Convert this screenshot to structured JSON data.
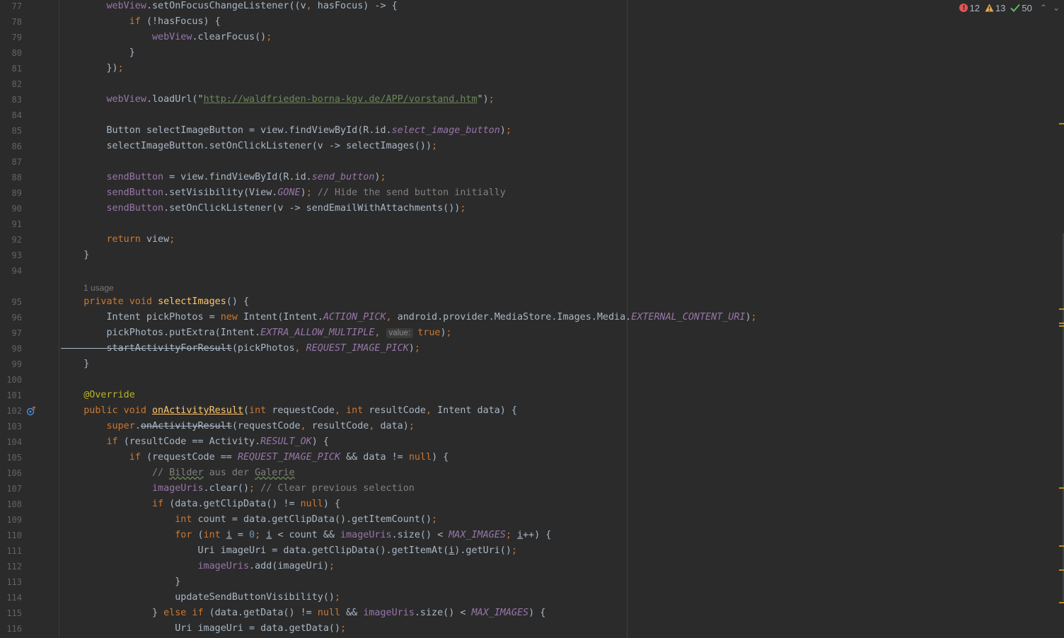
{
  "editor": {
    "usage_hint": "1 usage",
    "inlay_hint": "value:",
    "first_line": 77
  },
  "inspections": {
    "errors": "12",
    "warnings": "13",
    "weak_warnings": "50",
    "error_icon": "error-circle-icon",
    "warning_icon": "warning-triangle-icon",
    "ok_icon": "checkmark-icon",
    "colors": {
      "error": "#e05555",
      "warning": "#e0a84e",
      "ok": "#5fb85f",
      "stripe_mark": "#be9117"
    }
  },
  "code_lines": [
    {
      "n": "77",
      "t": [
        [
          "fld",
          "        webView"
        ],
        [
          "p",
          ".setOnFocusChangeListener((v"
        ],
        [
          "kw",
          ", "
        ],
        [
          "p",
          "hasFocus) -> {"
        ]
      ]
    },
    {
      "n": "78",
      "t": [
        [
          "kw",
          "            if "
        ],
        [
          "p",
          "(!hasFocus) {"
        ]
      ]
    },
    {
      "n": "79",
      "t": [
        [
          "fld",
          "                webView"
        ],
        [
          "p",
          ".clearFocus()"
        ],
        [
          "kw",
          ";"
        ]
      ]
    },
    {
      "n": "80",
      "t": [
        [
          "p",
          "            }"
        ]
      ]
    },
    {
      "n": "81",
      "t": [
        [
          "p",
          "        })"
        ],
        [
          "kw",
          ";"
        ]
      ]
    },
    {
      "n": "82",
      "t": []
    },
    {
      "n": "83",
      "t": [
        [
          "fld",
          "        webView"
        ],
        [
          "p",
          ".loadUrl(\""
        ],
        [
          "str",
          "http://waldfrieden-borna-kgv.de/APP/vorstand.htm"
        ],
        [
          "p",
          "\")"
        ],
        [
          "kw",
          ";"
        ]
      ]
    },
    {
      "n": "84",
      "t": []
    },
    {
      "n": "85",
      "t": [
        [
          "p",
          "        Button selectImageButton = view.findViewById(R.id."
        ],
        [
          "sfld",
          "select_image_button"
        ],
        [
          "p",
          ")"
        ],
        [
          "kw",
          ";"
        ]
      ]
    },
    {
      "n": "86",
      "t": [
        [
          "p",
          "        selectImageButton.setOnClickListener(v -> selectImages())"
        ],
        [
          "kw",
          ";"
        ]
      ]
    },
    {
      "n": "87",
      "t": []
    },
    {
      "n": "88",
      "t": [
        [
          "fld",
          "        sendButton"
        ],
        [
          "p",
          " = view.findViewById(R.id."
        ],
        [
          "sfld",
          "send_button"
        ],
        [
          "p",
          ")"
        ],
        [
          "kw",
          ";"
        ]
      ]
    },
    {
      "n": "89",
      "t": [
        [
          "fld",
          "        sendButton"
        ],
        [
          "p",
          ".setVisibility(View."
        ],
        [
          "sfld",
          "GONE"
        ],
        [
          "p",
          ")"
        ],
        [
          "kw",
          "; "
        ],
        [
          "cmt",
          "// Hide the send button initially"
        ]
      ]
    },
    {
      "n": "90",
      "t": [
        [
          "fld",
          "        sendButton"
        ],
        [
          "p",
          ".setOnClickListener(v -> sendEmailWithAttachments())"
        ],
        [
          "kw",
          ";"
        ]
      ]
    },
    {
      "n": "91",
      "t": []
    },
    {
      "n": "92",
      "t": [
        [
          "kw",
          "        return "
        ],
        [
          "p",
          "view"
        ],
        [
          "kw",
          ";"
        ]
      ]
    },
    {
      "n": "93",
      "t": [
        [
          "p",
          "    }"
        ]
      ]
    },
    {
      "n": "94",
      "t": []
    },
    {
      "hint": true
    },
    {
      "n": "95",
      "t": [
        [
          "kw",
          "    private void "
        ],
        [
          "mdecl",
          "selectImages"
        ],
        [
          "p",
          "() {"
        ]
      ]
    },
    {
      "n": "96",
      "t": [
        [
          "p",
          "        Intent pickPhotos = "
        ],
        [
          "kw",
          "new "
        ],
        [
          "p",
          "Intent(Intent."
        ],
        [
          "sfld",
          "ACTION_PICK"
        ],
        [
          "kw",
          ", "
        ],
        [
          "p",
          "android.provider.MediaStore.Images.Media."
        ],
        [
          "sfld",
          "EXTERNAL_CONTENT_URI"
        ],
        [
          "p",
          ")"
        ],
        [
          "kw",
          ";"
        ]
      ]
    },
    {
      "n": "97",
      "t": [
        [
          "p",
          "        pickPhotos.putExtra(Intent."
        ],
        [
          "sfld",
          "EXTRA_ALLOW_MULTIPLE"
        ],
        [
          "kw",
          ", "
        ],
        [
          "inlay",
          "value:"
        ],
        [
          "kw",
          "true"
        ],
        [
          "p",
          ")"
        ],
        [
          "kw",
          ";"
        ]
      ]
    },
    {
      "n": "98",
      "t": [
        [
          "strike",
          "        startActivityForResult"
        ],
        [
          "p",
          "(pickPhotos"
        ],
        [
          "kw",
          ", "
        ],
        [
          "sfld",
          "REQUEST_IMAGE_PICK"
        ],
        [
          "p",
          ")"
        ],
        [
          "kw",
          ";"
        ]
      ]
    },
    {
      "n": "99",
      "t": [
        [
          "p",
          "    }"
        ]
      ]
    },
    {
      "n": "100",
      "t": []
    },
    {
      "n": "101",
      "t": [
        [
          "ann",
          "    @Override"
        ]
      ]
    },
    {
      "n": "102",
      "icon": true,
      "t": [
        [
          "kw",
          "    public void "
        ],
        [
          "mdeclstrike",
          "onActivityResult"
        ],
        [
          "p",
          "("
        ],
        [
          "kw",
          "int "
        ],
        [
          "p",
          "requestCode"
        ],
        [
          "kw",
          ", int "
        ],
        [
          "p",
          "resultCode"
        ],
        [
          "kw",
          ", "
        ],
        [
          "p",
          "Intent data) {"
        ]
      ]
    },
    {
      "n": "103",
      "t": [
        [
          "kw",
          "        super"
        ],
        [
          "p",
          "."
        ],
        [
          "strike",
          "onActivityResult"
        ],
        [
          "p",
          "(requestCode"
        ],
        [
          "kw",
          ", "
        ],
        [
          "p",
          "resultCode"
        ],
        [
          "kw",
          ", "
        ],
        [
          "p",
          "data)"
        ],
        [
          "kw",
          ";"
        ]
      ]
    },
    {
      "n": "104",
      "t": [
        [
          "kw",
          "        if "
        ],
        [
          "p",
          "(resultCode == Activity."
        ],
        [
          "sfld",
          "RESULT_OK"
        ],
        [
          "p",
          ") {"
        ]
      ]
    },
    {
      "n": "105",
      "t": [
        [
          "kw",
          "            if "
        ],
        [
          "p",
          "(requestCode == "
        ],
        [
          "sfld",
          "REQUEST_IMAGE_PICK"
        ],
        [
          "p",
          " && data != "
        ],
        [
          "kw",
          "null"
        ],
        [
          "p",
          ") {"
        ]
      ]
    },
    {
      "n": "106",
      "t": [
        [
          "cmt",
          "                // "
        ],
        [
          "cmtsq",
          "Bilder"
        ],
        [
          "cmt",
          " aus der "
        ],
        [
          "cmtsq",
          "Galerie"
        ]
      ]
    },
    {
      "n": "107",
      "t": [
        [
          "fld",
          "                imageUris"
        ],
        [
          "p",
          ".clear()"
        ],
        [
          "kw",
          "; "
        ],
        [
          "cmt",
          "// Clear previous selection"
        ]
      ]
    },
    {
      "n": "108",
      "t": [
        [
          "kw",
          "                if "
        ],
        [
          "p",
          "(data.getClipData() != "
        ],
        [
          "kw",
          "null"
        ],
        [
          "p",
          ") {"
        ]
      ]
    },
    {
      "n": "109",
      "t": [
        [
          "kw",
          "                    int "
        ],
        [
          "p",
          "count = data.getClipData().getItemCount()"
        ],
        [
          "kw",
          ";"
        ]
      ]
    },
    {
      "n": "110",
      "t": [
        [
          "kw",
          "                    for "
        ],
        [
          "p",
          "("
        ],
        [
          "kw",
          "int "
        ],
        [
          "ul",
          "i"
        ],
        [
          "p",
          " = "
        ],
        [
          "num",
          "0"
        ],
        [
          "kw",
          "; "
        ],
        [
          "ul",
          "i"
        ],
        [
          "p",
          " < count && "
        ],
        [
          "fld",
          "imageUris"
        ],
        [
          "p",
          ".size() < "
        ],
        [
          "sfld",
          "MAX_IMAGES"
        ],
        [
          "kw",
          "; "
        ],
        [
          "ul",
          "i"
        ],
        [
          "p",
          "++) {"
        ]
      ]
    },
    {
      "n": "111",
      "t": [
        [
          "p",
          "                        Uri imageUri = data.getClipData().getItemAt("
        ],
        [
          "ul",
          "i"
        ],
        [
          "p",
          ").getUri()"
        ],
        [
          "kw",
          ";"
        ]
      ]
    },
    {
      "n": "112",
      "t": [
        [
          "fld",
          "                        imageUris"
        ],
        [
          "p",
          ".add(imageUri)"
        ],
        [
          "kw",
          ";"
        ]
      ]
    },
    {
      "n": "113",
      "t": [
        [
          "p",
          "                    }"
        ]
      ]
    },
    {
      "n": "114",
      "t": [
        [
          "p",
          "                    updateSendButtonVisibility()"
        ],
        [
          "kw",
          ";"
        ]
      ]
    },
    {
      "n": "115",
      "t": [
        [
          "p",
          "                } "
        ],
        [
          "kw",
          "else if "
        ],
        [
          "p",
          "(data.getData() != "
        ],
        [
          "kw",
          "null "
        ],
        [
          "p",
          "&& "
        ],
        [
          "fld",
          "imageUris"
        ],
        [
          "p",
          ".size() < "
        ],
        [
          "sfld",
          "MAX_IMAGES"
        ],
        [
          "p",
          ") {"
        ]
      ]
    },
    {
      "n": "116",
      "t": [
        [
          "p",
          "                    Uri imageUri = data.getData()"
        ],
        [
          "kw",
          ";"
        ]
      ]
    }
  ]
}
